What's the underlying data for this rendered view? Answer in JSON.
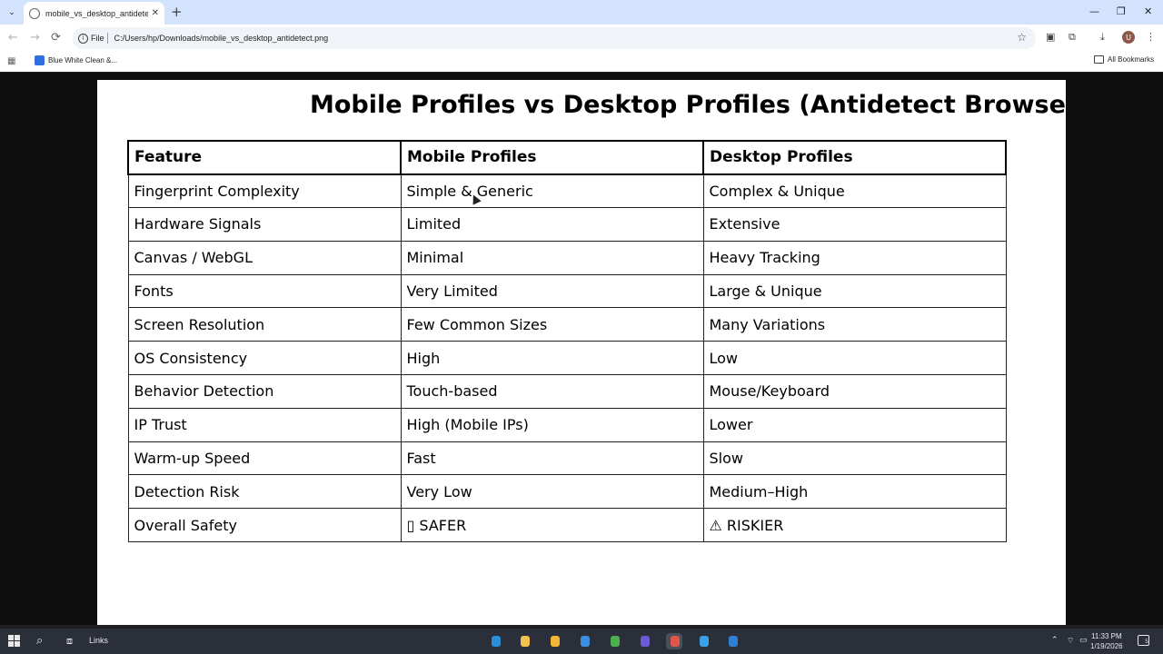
{
  "browser": {
    "tab": {
      "title": "mobile_vs_desktop_antidetect.png",
      "close_glyph": "✕"
    },
    "new_tab_glyph": "+",
    "window_controls": {
      "minimize": "—",
      "restore": "❐",
      "close": "✕"
    },
    "toolbar": {
      "back": "←",
      "forward": "→",
      "reload": "⟳",
      "scheme_label": "File",
      "url": "C:/Users/hp/Downloads/mobile_vs_desktop_antidetect.png",
      "star": "☆",
      "avatar_letter": "U",
      "menu": "⋮"
    },
    "bookmarks": {
      "items": [
        {
          "label": "Blue White Clean &..."
        }
      ],
      "all_label": "All Bookmarks"
    }
  },
  "document": {
    "title": "Mobile Profiles vs Desktop Profiles (Antidetect Browser",
    "table": {
      "headers": [
        "Feature",
        "Mobile Profiles",
        "Desktop Profiles"
      ],
      "rows": [
        [
          "Fingerprint Complexity",
          "Simple & Generic",
          "Complex & Unique"
        ],
        [
          "Hardware Signals",
          "Limited",
          "Extensive"
        ],
        [
          "Canvas / WebGL",
          "Minimal",
          "Heavy Tracking"
        ],
        [
          "Fonts",
          "Very Limited",
          "Large & Unique"
        ],
        [
          "Screen Resolution",
          "Few Common Sizes",
          "Many Variations"
        ],
        [
          "OS Consistency",
          "High",
          "Low"
        ],
        [
          "Behavior Detection",
          "Touch-based",
          "Mouse/Keyboard"
        ],
        [
          "IP Trust",
          "High (Mobile IPs)",
          "Lower"
        ],
        [
          "Warm-up Speed",
          "Fast",
          "Slow"
        ],
        [
          "Detection Risk",
          "Very Low",
          "Medium–High"
        ],
        [
          "Overall Safety",
          "▯ SAFER",
          "⚠ RISKIER"
        ]
      ]
    }
  },
  "taskbar": {
    "links_label": "Links",
    "apps": [
      {
        "name": "edge",
        "color": "#2a8fd8"
      },
      {
        "name": "file-explorer",
        "color": "#f2c14e"
      },
      {
        "name": "store",
        "color": "#f5b733"
      },
      {
        "name": "mail",
        "color": "#3d8ee0"
      },
      {
        "name": "chrome-alt",
        "color": "#4caf50"
      },
      {
        "name": "app-u",
        "color": "#6b5bd6"
      },
      {
        "name": "chrome",
        "color": "#e0574a"
      },
      {
        "name": "draw",
        "color": "#3aa0e8"
      },
      {
        "name": "vscode",
        "color": "#2f7fd6"
      }
    ],
    "time": "11:33 PM",
    "date": "1/19/2026",
    "notification_count": "5"
  }
}
